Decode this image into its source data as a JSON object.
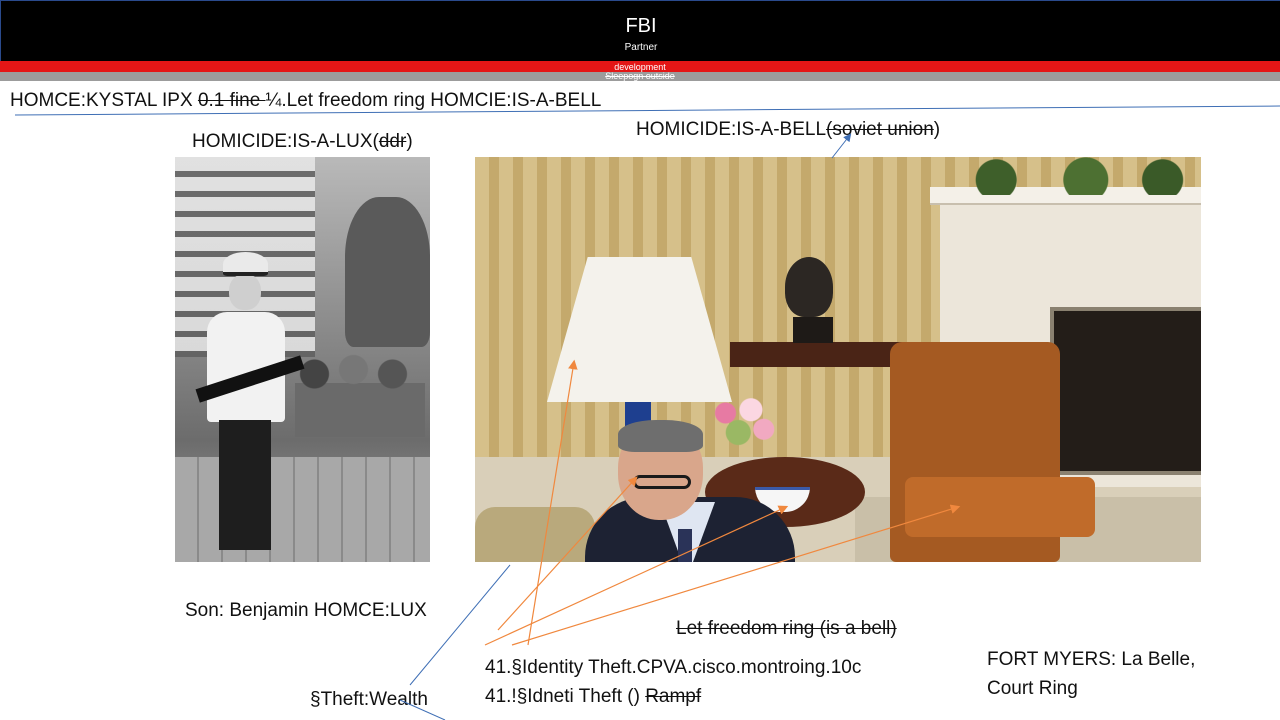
{
  "header": {
    "title": "FBI",
    "subtitle": "Partner",
    "band_red_label": "development",
    "band_gray_label": "Sleepogn outside"
  },
  "headline": {
    "part1": "HOMCE:KYSTAL IPX ",
    "struck": "0.1 fine ",
    "part2": "¼.Let freedom ring HOMCIE:IS-A-BELL"
  },
  "caption_left": {
    "text": "HOMICIDE:IS-A-LUX(",
    "struck": "ddr",
    "close": ")"
  },
  "caption_right": {
    "text": "HOMICIDE:IS-A-BELL",
    "struck": "(soviet union",
    "close": ")"
  },
  "son_label": "Son: Benjamin HOMCE:LUX",
  "let_freedom_struck": "Let freedom ring (is a bell)",
  "identity_line1": "41.§Identity Theft.CPVA.cisco.montroing.10c",
  "identity_line2": {
    "text": "41.!§Idneti Theft () ",
    "struck": "Rampf"
  },
  "fort_myers": {
    "line1": "FORT MYERS: La Belle,",
    "line2": "Court Ring"
  },
  "theft_wealth": "§Theft:Wealth",
  "colors": {
    "header_bg": "#000000",
    "red_band": "#e41616",
    "gray_band": "#9c9c9c",
    "arrow_orange": "#f0883e",
    "arrow_blue": "#3f6fb5"
  }
}
